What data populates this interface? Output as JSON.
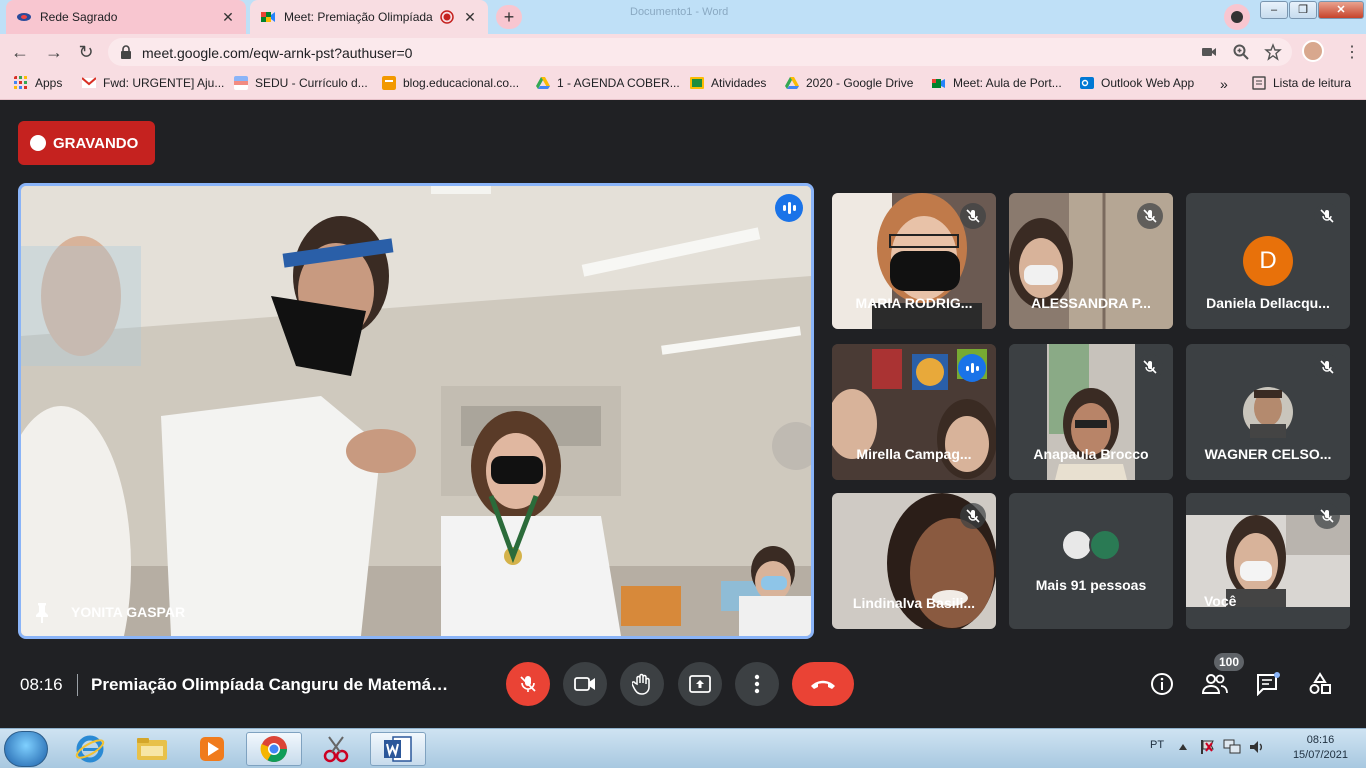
{
  "browser": {
    "tabs": [
      {
        "label": "Rede Sagrado",
        "close": "✕",
        "active": false
      },
      {
        "label": "Meet: Premiação Olimpíada",
        "close": "✕",
        "active": true
      }
    ],
    "new_tab": "+",
    "ghost_title": "Documento1 - Word",
    "url": "meet.google.com/eqw-arnk-pst?authuser=0",
    "bookmarks": [
      {
        "label": "Apps",
        "color": "#5f6368"
      },
      {
        "label": "Fwd: URGENTE] Aju...",
        "color": "#d93025"
      },
      {
        "label": "SEDU - Currículo d...",
        "color": "#8ab4f8"
      },
      {
        "label": "blog.educacional.co...",
        "color": "#f29900"
      },
      {
        "label": "1 - AGENDA COBER...",
        "color": "#34a853"
      },
      {
        "label": "Atividades",
        "color": "#fbbc04"
      },
      {
        "label": "2020 - Google Drive",
        "color": "#34a853"
      },
      {
        "label": "Meet: Aula de Port...",
        "color": "#00832d"
      },
      {
        "label": "Outlook Web App",
        "color": "#0078d4"
      }
    ],
    "bookmarks_more": "»",
    "reading_list": "Lista de leitura"
  },
  "meet": {
    "recording_label": "GRAVANDO",
    "main_participant": "YONITA GASPAR",
    "participants": [
      {
        "name": "MARIA RODRIG...",
        "muted": true,
        "bg": "#6b5a52"
      },
      {
        "name": "ALESSANDRA P...",
        "muted": true,
        "bg": "#8a7a6e"
      },
      {
        "name": "Daniela Dellacqu...",
        "muted": true,
        "bg": "#3c4043",
        "initial": "D"
      },
      {
        "name": "Mirella Campag...",
        "muted": false,
        "bg": "#4a3b35"
      },
      {
        "name": "Anapaula Brocco",
        "muted": true,
        "bg": "#c7c2bb"
      },
      {
        "name": "WAGNER CELSO...",
        "muted": true,
        "bg": "#3c4043"
      },
      {
        "name": "Lindinalva Basili...",
        "muted": true,
        "bg": "#cfcac4"
      },
      {
        "name": "Mais 91 pessoas",
        "muted": false,
        "bg": "#3c4043"
      },
      {
        "name": "Você",
        "muted": true,
        "bg": "#d9d6d2"
      }
    ],
    "time": "08:16",
    "meeting_title": "Premiação Olimpíada Canguru de Matemática",
    "participants_count": "100"
  },
  "taskbar": {
    "lang": "PT",
    "clock_time": "08:16",
    "clock_date": "15/07/2021"
  }
}
